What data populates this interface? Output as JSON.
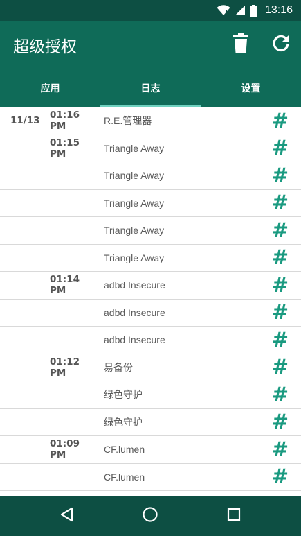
{
  "status_bar": {
    "time": "13:16"
  },
  "app_bar": {
    "title": "超级授权"
  },
  "tabs": [
    {
      "label": "应用",
      "active": false
    },
    {
      "label": "日志",
      "active": true
    },
    {
      "label": "设置",
      "active": false
    }
  ],
  "log_entries": [
    {
      "date": "11/13",
      "time": "01:16 PM",
      "app": "R.E.管理器",
      "icon": "#"
    },
    {
      "date": "",
      "time": "01:15 PM",
      "app": "Triangle Away",
      "icon": "#"
    },
    {
      "date": "",
      "time": "",
      "app": "Triangle Away",
      "icon": "#"
    },
    {
      "date": "",
      "time": "",
      "app": "Triangle Away",
      "icon": "#"
    },
    {
      "date": "",
      "time": "",
      "app": "Triangle Away",
      "icon": "#"
    },
    {
      "date": "",
      "time": "",
      "app": "Triangle Away",
      "icon": "#"
    },
    {
      "date": "",
      "time": "01:14 PM",
      "app": "adbd Insecure",
      "icon": "#"
    },
    {
      "date": "",
      "time": "",
      "app": "adbd Insecure",
      "icon": "#"
    },
    {
      "date": "",
      "time": "",
      "app": "adbd Insecure",
      "icon": "#"
    },
    {
      "date": "",
      "time": "01:12 PM",
      "app": "易备份",
      "icon": "#"
    },
    {
      "date": "",
      "time": "",
      "app": "绿色守护",
      "icon": "#"
    },
    {
      "date": "",
      "time": "",
      "app": "绿色守护",
      "icon": "#"
    },
    {
      "date": "",
      "time": "01:09 PM",
      "app": "CF.lumen",
      "icon": "#"
    },
    {
      "date": "",
      "time": "",
      "app": "CF.lumen",
      "icon": "#"
    }
  ],
  "colors": {
    "app_bar": "#0f6b58",
    "status_bar": "#0d4f43",
    "tab_indicator": "#6fd1bf",
    "hash_icon": "#1a9a80"
  },
  "icons": {
    "wifi": "wifi-icon",
    "signal": "signal-icon",
    "battery": "battery-icon",
    "trash": "trash-icon",
    "refresh": "refresh-icon",
    "back": "back-icon",
    "home": "home-icon",
    "recents": "recents-icon"
  }
}
